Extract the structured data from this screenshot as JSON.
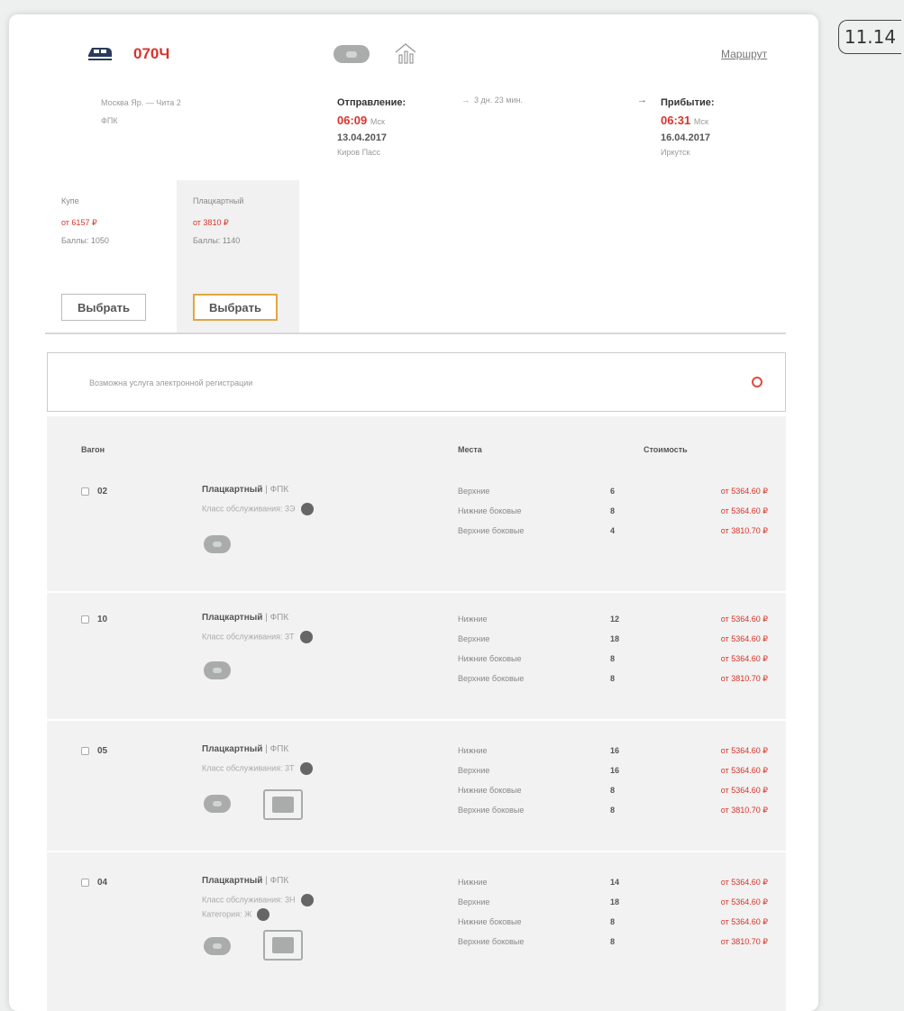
{
  "figure_label": "11.14",
  "header": {
    "train_number": "070Ч",
    "route_link": "Маршрут",
    "route_name": "Москва Яр. — Чита 2",
    "carrier": "ФПК",
    "departure": {
      "label": "Отправление:",
      "time": "06:09",
      "tz": "Мск",
      "date": "13.04.2017",
      "station": "Киров Пасс"
    },
    "travel_time": "3 дн. 23 мин.",
    "arrival": {
      "label": "Прибытие:",
      "time": "06:31",
      "tz": "Мск",
      "date": "16.04.2017",
      "station": "Иркутск"
    },
    "arrow": "→"
  },
  "classes": [
    {
      "name": "Купе",
      "price": "от 6157 ₽",
      "points": "Баллы: 1050",
      "button": "Выбрать"
    },
    {
      "name": "Плацкартный",
      "price": "от 3810 ₽",
      "points": "Баллы: 1140",
      "button": "Выбрать"
    }
  ],
  "registration": {
    "text": "Возможна услуга электронной регистрации"
  },
  "table": {
    "headers": {
      "car": "Вагон",
      "seats": "Места",
      "cost": "Стоимость"
    },
    "rows": [
      {
        "car": "02",
        "type": "Плацкартный",
        "carrier": "| ФПК",
        "service_class": "Класс обслуживания: 3Э",
        "seats": [
          {
            "type": "Верхние",
            "count": "6",
            "price": "от 5364.60 ₽"
          },
          {
            "type": "Нижние боковые",
            "count": "8",
            "price": "от 5364.60 ₽"
          },
          {
            "type": "Верхние боковые",
            "count": "4",
            "price": "от 3810.70 ₽"
          }
        ]
      },
      {
        "car": "10",
        "type": "Плацкартный",
        "carrier": "| ФПК",
        "service_class": "Класс обслуживания: 3Т",
        "seats": [
          {
            "type": "Нижние",
            "count": "12",
            "price": "от 5364.60 ₽"
          },
          {
            "type": "Верхние",
            "count": "18",
            "price": "от 5364.60 ₽"
          },
          {
            "type": "Нижние боковые",
            "count": "8",
            "price": "от 5364.60 ₽"
          },
          {
            "type": "Верхние боковые",
            "count": "8",
            "price": "от 3810.70 ₽"
          }
        ]
      },
      {
        "car": "05",
        "type": "Плацкартный",
        "carrier": "| ФПК",
        "service_class": "Класс обслуживания: 3Т",
        "seats": [
          {
            "type": "Нижние",
            "count": "16",
            "price": "от 5364.60 ₽"
          },
          {
            "type": "Верхние",
            "count": "16",
            "price": "от 5364.60 ₽"
          },
          {
            "type": "Нижние боковые",
            "count": "8",
            "price": "от 5364.60 ₽"
          },
          {
            "type": "Верхние боковые",
            "count": "8",
            "price": "от 3810.70 ₽"
          }
        ]
      },
      {
        "car": "04",
        "type": "Плацкартный",
        "carrier": "| ФПК",
        "service_class": "Класс обслуживания: 3Н",
        "category": "Категория: Ж",
        "seats": [
          {
            "type": "Нижние",
            "count": "14",
            "price": "от 5364.60 ₽"
          },
          {
            "type": "Верхние",
            "count": "18",
            "price": "от 5364.60 ₽"
          },
          {
            "type": "Нижние боковые",
            "count": "8",
            "price": "от 5364.60 ₽"
          },
          {
            "type": "Верхние боковые",
            "count": "8",
            "price": "от 3810.70 ₽"
          }
        ]
      }
    ]
  },
  "colors": {
    "accent": "#d9332b",
    "selected_border": "#e2a640",
    "panel_bg": "#f1f2f1"
  }
}
